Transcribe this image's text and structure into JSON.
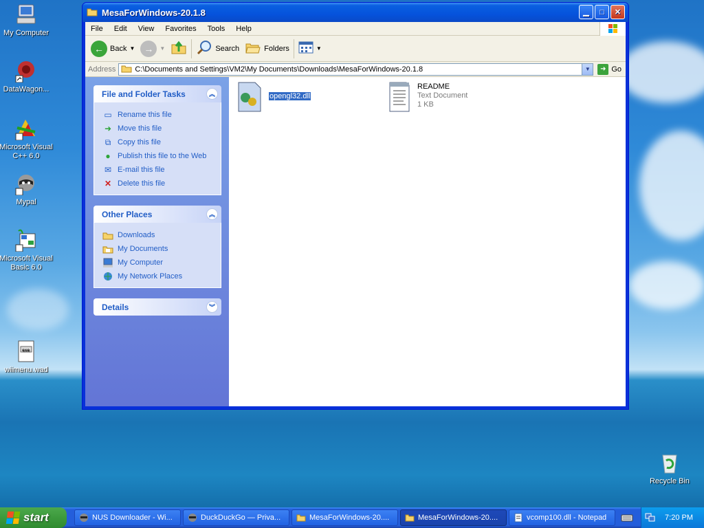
{
  "desktop": {
    "icons": [
      {
        "label": "My Computer",
        "icon": "my-computer-icon"
      },
      {
        "label": "DataWagon...",
        "icon": "datawagon-icon"
      },
      {
        "label": "Microsoft Visual C++ 6.0",
        "icon": "visual-cpp-icon"
      },
      {
        "label": "Mypal",
        "icon": "mypal-icon"
      },
      {
        "label": "Microsoft Visual Basic 6.0",
        "icon": "visual-basic-icon"
      },
      {
        "label": "wiimenu.wad",
        "icon": "wad-file-icon"
      }
    ],
    "recycle_bin": "Recycle Bin"
  },
  "window": {
    "title": "MesaForWindows-20.1.8",
    "menu": [
      "File",
      "Edit",
      "View",
      "Favorites",
      "Tools",
      "Help"
    ],
    "toolbar": {
      "back": "Back",
      "search": "Search",
      "folders": "Folders"
    },
    "address": {
      "label": "Address",
      "path": "C:\\Documents and Settings\\VM2\\My Documents\\Downloads\\MesaForWindows-20.1.8",
      "go": "Go"
    },
    "file_tasks": {
      "title": "File and Folder Tasks",
      "items": [
        "Rename this file",
        "Move this file",
        "Copy this file",
        "Publish this file to the Web",
        "E-mail this file",
        "Delete this file"
      ]
    },
    "other_places": {
      "title": "Other Places",
      "items": [
        "Downloads",
        "My Documents",
        "My Computer",
        "My Network Places"
      ]
    },
    "details": {
      "title": "Details"
    },
    "files": [
      {
        "name": "opengl32.dll",
        "selected": true
      },
      {
        "name": "README",
        "type": "Text Document",
        "size": "1 KB"
      }
    ]
  },
  "taskbar": {
    "start": "start",
    "tasks": [
      "NUS Downloader - Wi...",
      "DuckDuckGo — Priva...",
      "MesaForWindows-20....",
      "MesaForWindows-20....",
      "vcomp100.dll - Notepad"
    ],
    "active_task_index": 3,
    "clock": "7:20 PM"
  },
  "colors": {
    "accent": "#245edb",
    "selection": "#316ac5",
    "link": "#215dc6"
  }
}
